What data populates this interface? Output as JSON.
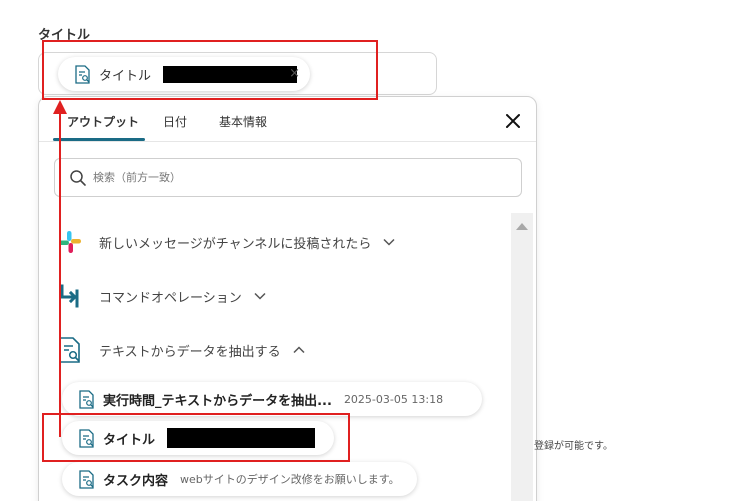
{
  "field": {
    "label": "タイトル",
    "chip_label": "タイトル",
    "remove_icon": "×"
  },
  "panel": {
    "tabs": [
      {
        "label": "アウトプット",
        "active": true
      },
      {
        "label": "日付",
        "active": false
      },
      {
        "label": "基本情報",
        "active": false
      }
    ],
    "search_placeholder": "検索（前方一致）",
    "sections": [
      {
        "label": "新しいメッセージがチャンネルに投稿されたら",
        "icon": "slack-icon",
        "expanded": false
      },
      {
        "label": "コマンドオペレーション",
        "icon": "command-operation-icon",
        "expanded": false
      },
      {
        "label": "テキストからデータを抽出する",
        "icon": "document-search-icon",
        "expanded": true
      }
    ],
    "items": [
      {
        "label": "実行時間_テキストからデータを抽出...",
        "value": "2025-03-05 13:18"
      },
      {
        "label": "タイトル",
        "value": ""
      },
      {
        "label": "タスク内容",
        "value": "webサイトのデザイン改修をお願いします。"
      }
    ]
  },
  "background_text": "登録が可能です。",
  "colors": {
    "accent": "#1a6b85",
    "annotation": "#e02020"
  }
}
